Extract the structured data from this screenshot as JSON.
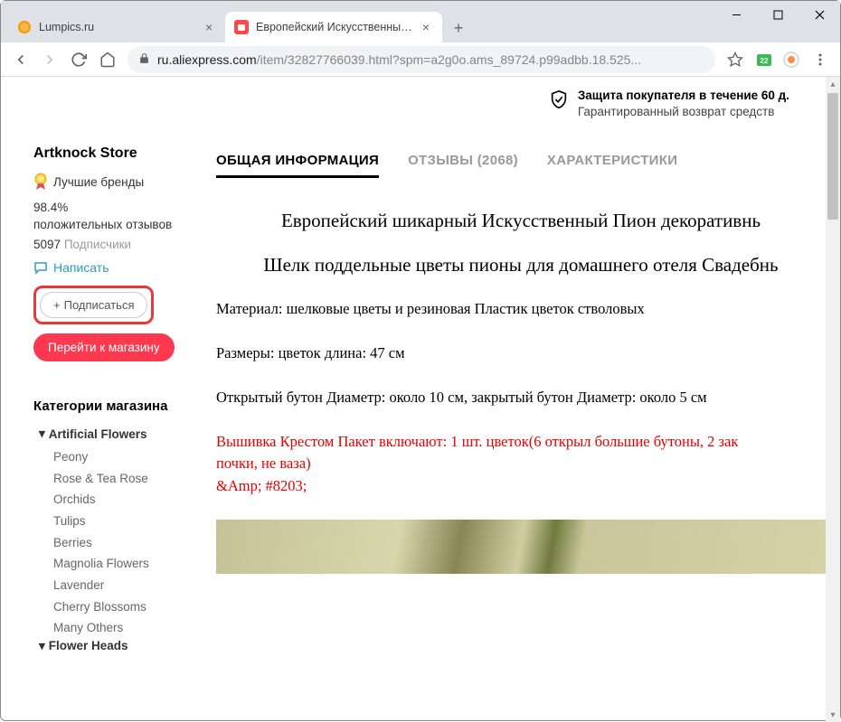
{
  "browser": {
    "tabs": [
      {
        "title": "Lumpics.ru",
        "favicon": "orange"
      },
      {
        "title": "Европейский Искусственный П",
        "favicon": "aliexpress"
      }
    ],
    "url_domain": "ru.aliexpress.com",
    "url_path": "/item/32827766039.html?spm=a2g0o.ams_89724.p99adbb.18.525..."
  },
  "protection": {
    "line1": "Защита покупателя в течение 60 д.",
    "line2": "Гарантированный возврат средств"
  },
  "store": {
    "name": "Artknock Store",
    "badge_label": "Лучшие бренды",
    "rating_percent": "98.4%",
    "rating_label": "положительных отзывов",
    "followers_count": "5097",
    "followers_label": "Подписчики",
    "write_label": "Написать",
    "subscribe_label": "Подписаться",
    "goto_label": "Перейти к магазину"
  },
  "categories": {
    "title": "Категории магазина",
    "groups": [
      {
        "header": "Artificial Flowers",
        "items": [
          "Peony",
          "Rose & Tea Rose",
          "Orchids",
          "Tulips",
          "Berries",
          "Magnolia Flowers",
          "Lavender",
          "Cherry Blossoms",
          "Many Others"
        ]
      },
      {
        "header": "Flower Heads",
        "items": []
      }
    ]
  },
  "tabs_nav": {
    "info": "ОБЩАЯ ИНФОРМАЦИЯ",
    "reviews": "ОТЗЫВЫ (2068)",
    "specs": "ХАРАКТЕРИСТИКИ"
  },
  "product": {
    "title1": "Европейский шикарный Искусственный Пион декоративнь",
    "title2": "Шелк поддельные цветы пионы для домашнего отеля Свадебнь",
    "material": "Материал: шелковые цветы и резиновая Пластик цветок стволовых",
    "size": "Размеры: цветок длина: 47 см",
    "diameter": "Открытый бутон Диаметр: около 10 см, закрытый бутон Диаметр: около 5 см",
    "package1": "Вышивка Крестом Пакет включают: 1 шт. цветок(6 открыл большие бутоны, 2 зак",
    "package2": "почки, не ваза)",
    "amp": "&Amp; #8203;"
  }
}
